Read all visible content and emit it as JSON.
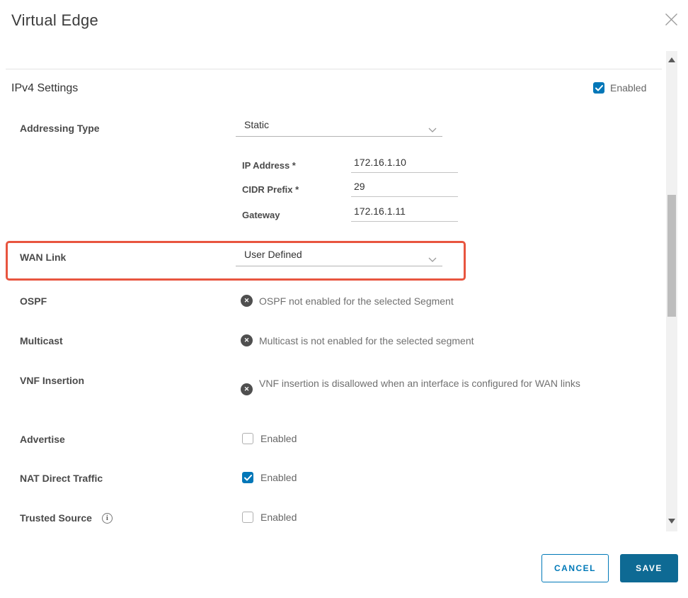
{
  "dialog": {
    "title": "Virtual Edge"
  },
  "section": {
    "title": "IPv4 Settings",
    "enabled_label": "Enabled",
    "enabled_checked": true
  },
  "fields": {
    "addressing_type": {
      "label": "Addressing Type",
      "value": "Static"
    },
    "ip_address": {
      "label": "IP Address *",
      "value": "172.16.1.10"
    },
    "cidr_prefix": {
      "label": "CIDR Prefix *",
      "value": "29"
    },
    "gateway": {
      "label": "Gateway",
      "value": "172.16.1.11"
    },
    "wan_link": {
      "label": "WAN Link",
      "value": "User Defined",
      "highlighted": true
    },
    "ospf": {
      "label": "OSPF",
      "status": "OSPF not enabled for the selected Segment"
    },
    "multicast": {
      "label": "Multicast",
      "status": "Multicast is not enabled for the selected segment"
    },
    "vnf_insertion": {
      "label": "VNF Insertion",
      "status": "VNF insertion is disallowed when an interface is configured for WAN links"
    },
    "advertise": {
      "label": "Advertise",
      "checkbox_label": "Enabled",
      "checked": false
    },
    "nat_direct_traffic": {
      "label": "NAT Direct Traffic",
      "checkbox_label": "Enabled",
      "checked": true
    },
    "trusted_source": {
      "label": "Trusted Source",
      "checkbox_label": "Enabled",
      "checked": false
    }
  },
  "status_icon_glyph": "✕",
  "footer": {
    "cancel_label": "CANCEL",
    "save_label": "SAVE"
  },
  "colors": {
    "accent_blue": "#0277b8",
    "save_button": "#0e6a94",
    "highlight_red": "#e8553f"
  }
}
